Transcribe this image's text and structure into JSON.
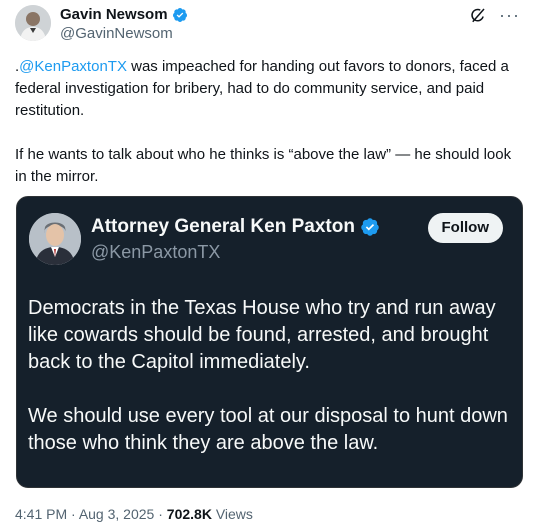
{
  "author": {
    "name": "Gavin Newsom",
    "handle": "@GavinNewsom"
  },
  "tweet": {
    "mention": "@KenPaxtonTX",
    "line1_prefix": ".",
    "line1_rest": " was impeached for handing out favors to donors, faced a federal investigation for bribery, had to do community service, and paid restitution.",
    "paragraph2": "If he wants to talk about who he thinks is “above the law” — he should look in the mirror."
  },
  "quote": {
    "name": "Attorney General Ken Paxton",
    "handle": "@KenPaxtonTX",
    "follow_label": "Follow",
    "paragraph1": "Democrats in the Texas House who try and run away like cowards should be found, arrested, and brought back to the Capitol immediately.",
    "paragraph2": "We should use every tool at our disposal to hunt down those who think they are above the law."
  },
  "meta": {
    "time": "4:41 PM",
    "sep1": " · ",
    "date": "Aug 3, 2025",
    "sep2": " · ",
    "views_count": "702.8K",
    "views_label": " Views"
  },
  "icons": {
    "verified": "verified-badge-icon",
    "grok": "grok-icon",
    "more": "more-icon"
  },
  "colors": {
    "link": "#1d9bf0",
    "verified": "#1d9bf0",
    "quote_bg": "#15202b"
  }
}
